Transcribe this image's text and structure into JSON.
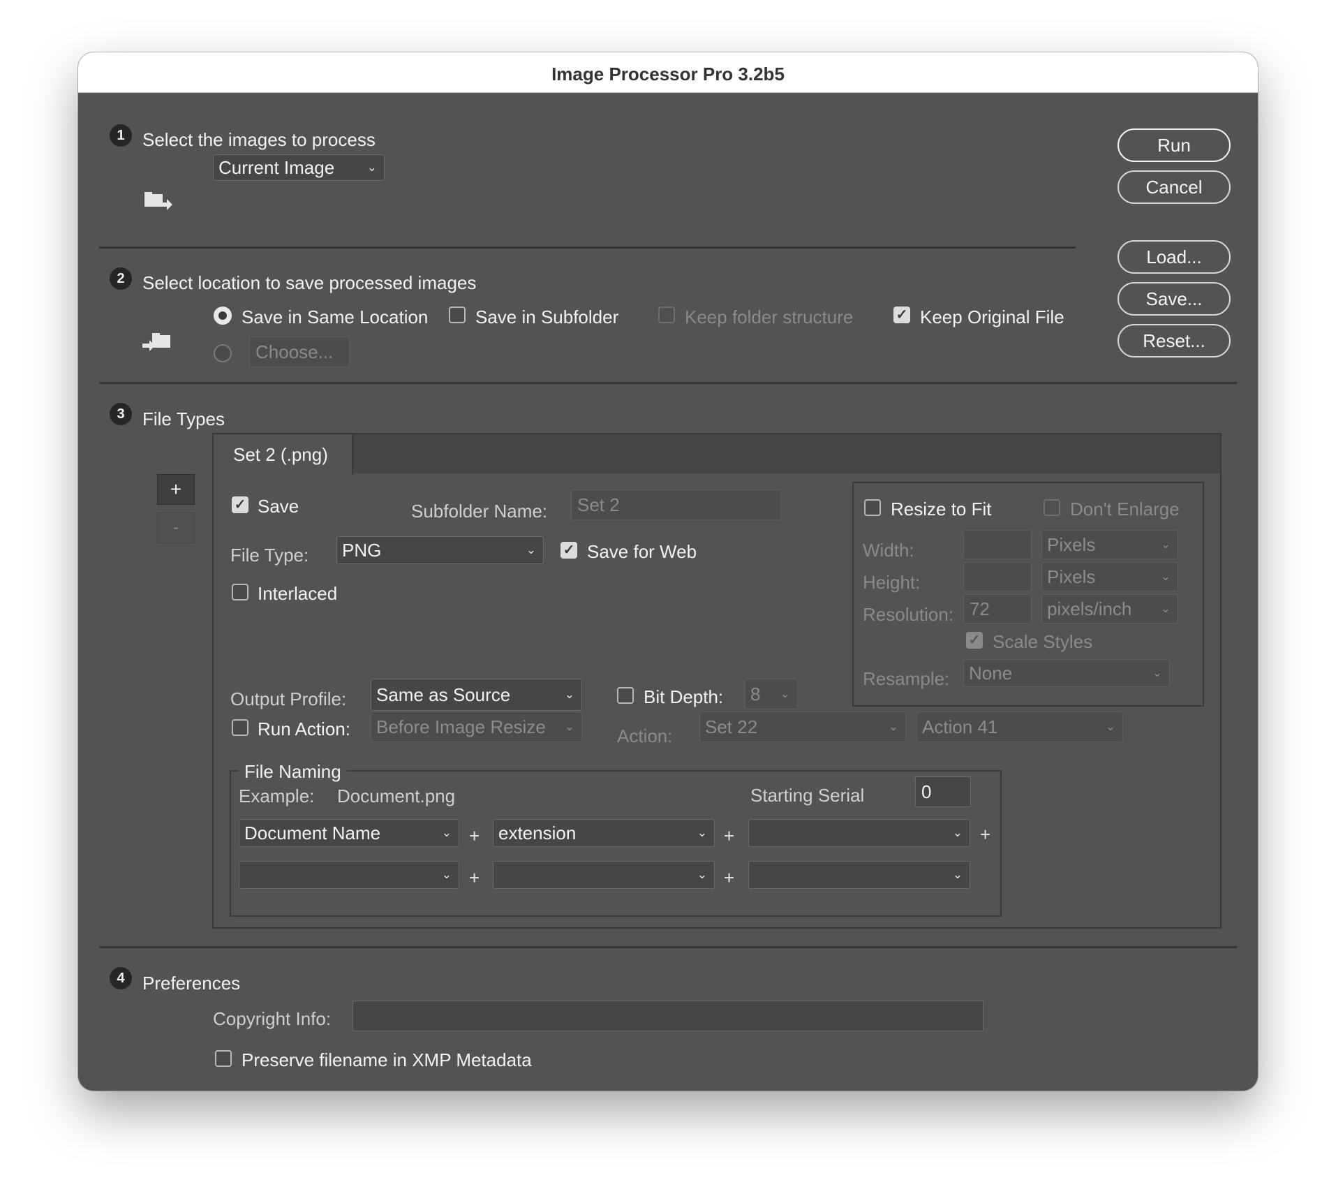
{
  "window": {
    "title": "Image Processor Pro 3.2b5"
  },
  "steps": {
    "s1": "1",
    "s2": "2",
    "s3": "3",
    "s4": "4"
  },
  "section1": {
    "heading": "Select the images to process",
    "source_select": "Current Image"
  },
  "section2": {
    "heading": "Select location to save processed images",
    "same_location_label": "Save in Same Location",
    "subfolder_label": "Save in Subfolder",
    "keep_structure_label": "Keep folder structure",
    "keep_original_label": "Keep Original File",
    "choose_button": "Choose..."
  },
  "side_buttons": {
    "run": "Run",
    "cancel": "Cancel",
    "load": "Load...",
    "save": "Save...",
    "reset": "Reset..."
  },
  "section3": {
    "heading": "File Types",
    "add_set": "+",
    "remove_set": "-",
    "tab_label": "Set 2 (.png)",
    "save_label": "Save",
    "subfolder_name_label": "Subfolder Name:",
    "subfolder_name_value": "Set 2",
    "file_type_label": "File Type:",
    "file_type_value": "PNG",
    "save_for_web_label": "Save for Web",
    "interlaced_label": "Interlaced",
    "resize": {
      "resize_to_fit_label": "Resize to Fit",
      "dont_enlarge_label": "Don't Enlarge",
      "width_label": "Width:",
      "width_unit": "Pixels",
      "height_label": "Height:",
      "height_unit": "Pixels",
      "resolution_label": "Resolution:",
      "resolution_value": "72",
      "resolution_unit": "pixels/inch",
      "scale_styles_label": "Scale Styles",
      "resample_label": "Resample:",
      "resample_value": "None"
    },
    "output_profile_label": "Output Profile:",
    "output_profile_value": "Same as Source",
    "bit_depth_label": "Bit Depth:",
    "bit_depth_value": "8",
    "run_action_label": "Run Action:",
    "run_action_value": "Before Image Resize",
    "action_label": "Action:",
    "action_set_value": "Set 22",
    "action_value": "Action 41",
    "naming": {
      "legend": "File Naming",
      "example_label": "Example:",
      "example_value": "Document.png",
      "starting_serial_label": "Starting Serial",
      "starting_serial_value": "0",
      "field1": "Document Name",
      "field2": "extension",
      "field3": "",
      "field4": "",
      "field5": "",
      "field6": "",
      "plus": "+"
    }
  },
  "section4": {
    "heading": "Preferences",
    "copyright_label": "Copyright Info:",
    "copyright_value": "",
    "preserve_label": "Preserve filename in XMP Metadata"
  },
  "icons": {
    "check": "✓",
    "chevron": "⌄"
  },
  "colors": {
    "panel": "#535353",
    "title_bar": "#ffffff",
    "field": "#464646",
    "separator": "#353535"
  }
}
